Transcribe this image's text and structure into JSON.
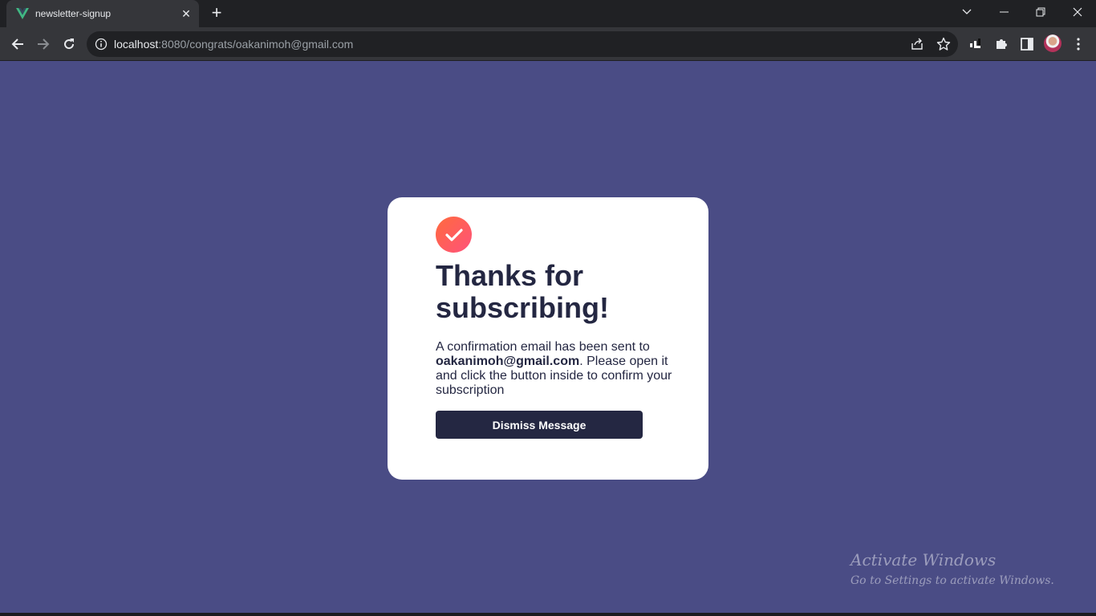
{
  "browser": {
    "tab_title": "newsletter-signup",
    "url_host": "localhost",
    "url_rest": ":8080/congrats/oakanimoh@gmail.com"
  },
  "card": {
    "title_line1": "Thanks for",
    "title_line2": "subscribing!",
    "message_before": "A confirmation email has been sent to ",
    "email": "oakanimoh@gmail.com",
    "message_after": ". Please open it and click the button inside to confirm your subscription",
    "button_label": "Dismiss Message"
  },
  "watermark": {
    "line1": "Activate Windows",
    "line2": "Go to Settings to activate Windows."
  },
  "colors": {
    "page_bg": "#4a4c85",
    "card_bg": "#ffffff",
    "text_dark": "#242742",
    "accent_gradient_start": "#ff6a3d",
    "accent_gradient_end": "#ff527b"
  },
  "icons": [
    "vue-favicon-icon",
    "close-icon",
    "plus-icon",
    "chevron-down-icon",
    "minimize-icon",
    "restore-icon",
    "back-icon",
    "forward-icon",
    "reload-icon",
    "info-icon",
    "share-icon",
    "star-icon",
    "extension-icon",
    "puzzle-icon",
    "sidepanel-icon",
    "avatar",
    "kebab-menu-icon",
    "check-icon"
  ]
}
